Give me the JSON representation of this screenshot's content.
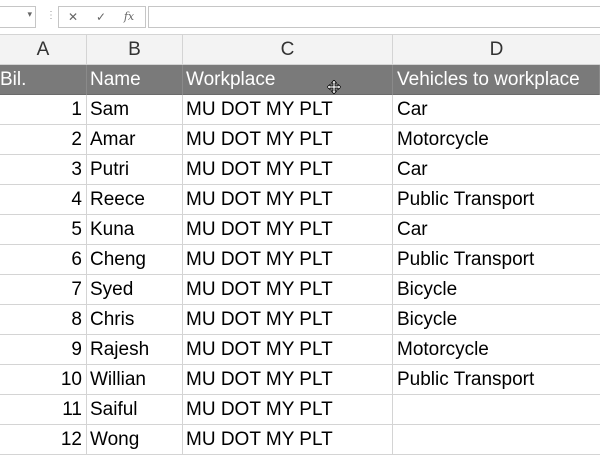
{
  "formula_bar": {
    "name_box_value": "",
    "dropdown_glyph": "▾",
    "separator_glyph": "⋮",
    "cancel_glyph": "✕",
    "enter_glyph": "✓",
    "fx_glyph": "fx",
    "formula_value": ""
  },
  "columns": [
    "A",
    "B",
    "C",
    "D"
  ],
  "header_row": {
    "a": "Bil.",
    "b": "Name",
    "c": "Workplace",
    "d": "Vehicles to workplace"
  },
  "rows": [
    {
      "num": "1",
      "name": "Sam",
      "workplace": "MU DOT MY PLT",
      "vehicle": "Car"
    },
    {
      "num": "2",
      "name": "Amar",
      "workplace": "MU DOT MY PLT",
      "vehicle": "Motorcycle"
    },
    {
      "num": "3",
      "name": "Putri",
      "workplace": "MU DOT MY PLT",
      "vehicle": "Car"
    },
    {
      "num": "4",
      "name": "Reece",
      "workplace": "MU DOT MY PLT",
      "vehicle": "Public Transport"
    },
    {
      "num": "5",
      "name": "Kuna",
      "workplace": "MU DOT MY PLT",
      "vehicle": "Car"
    },
    {
      "num": "6",
      "name": "Cheng",
      "workplace": "MU DOT MY PLT",
      "vehicle": "Public Transport"
    },
    {
      "num": "7",
      "name": "Syed",
      "workplace": "MU DOT MY PLT",
      "vehicle": "Bicycle"
    },
    {
      "num": "8",
      "name": "Chris",
      "workplace": "MU DOT MY PLT",
      "vehicle": "Bicycle"
    },
    {
      "num": "9",
      "name": "Rajesh",
      "workplace": "MU DOT MY PLT",
      "vehicle": "Motorcycle"
    },
    {
      "num": "10",
      "name": "Willian",
      "workplace": "MU DOT MY PLT",
      "vehicle": "Public Transport"
    },
    {
      "num": "11",
      "name": "Saiful",
      "workplace": "MU DOT MY PLT",
      "vehicle": ""
    },
    {
      "num": "12",
      "name": "Wong",
      "workplace": "MU DOT MY PLT",
      "vehicle": ""
    }
  ]
}
